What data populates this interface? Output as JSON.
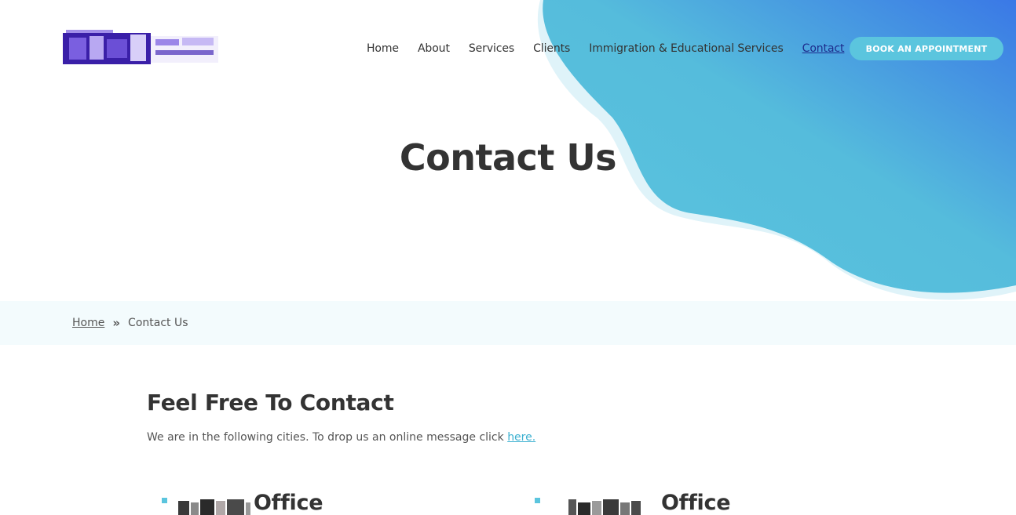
{
  "header": {
    "logo_label": "logo",
    "nav": [
      {
        "label": "Home",
        "active": false
      },
      {
        "label": "About",
        "active": false
      },
      {
        "label": "Services",
        "active": false
      },
      {
        "label": "Clients",
        "active": false
      },
      {
        "label": "Immigration & Educational Services",
        "active": false
      },
      {
        "label": "Contact",
        "active": true
      }
    ],
    "cta_label": "BOOK AN APPOINTMENT"
  },
  "hero": {
    "title": "Contact Us"
  },
  "breadcrumb": {
    "home_label": "Home",
    "separator_icon": "double-chevron-right-icon",
    "current_label": "Contact Us"
  },
  "main": {
    "title": "Feel Free To Contact",
    "intro_text": "We are in the following cities. To drop us an online message click ",
    "intro_link": "here.",
    "offices": [
      {
        "name": "Office"
      },
      {
        "name": "Office"
      }
    ]
  },
  "colors": {
    "accent": "#5bc5de",
    "gradient_end": "#3a7be6",
    "breadcrumb_bg": "#f3fbfd",
    "active_nav": "#1d2b8c"
  }
}
